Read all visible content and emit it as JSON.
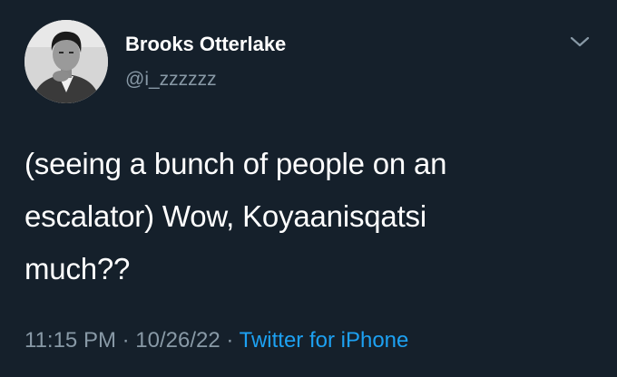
{
  "user": {
    "display_name": "Brooks Otterlake",
    "handle": "@i_zzzzzz"
  },
  "tweet": {
    "lines": [
      "(seeing a bunch of people on an",
      "escalator) Wow, Koyaanisqatsi",
      "much??"
    ]
  },
  "meta": {
    "time": "11:15 PM",
    "separator1": " · ",
    "date": "10/26/22",
    "separator2": " · ",
    "source": "Twitter for iPhone"
  },
  "icons": {
    "menu": "chevron-down-icon"
  },
  "colors": {
    "background": "#15202b",
    "text": "#ffffff",
    "secondary": "#8899a6",
    "link": "#1da1f2"
  }
}
